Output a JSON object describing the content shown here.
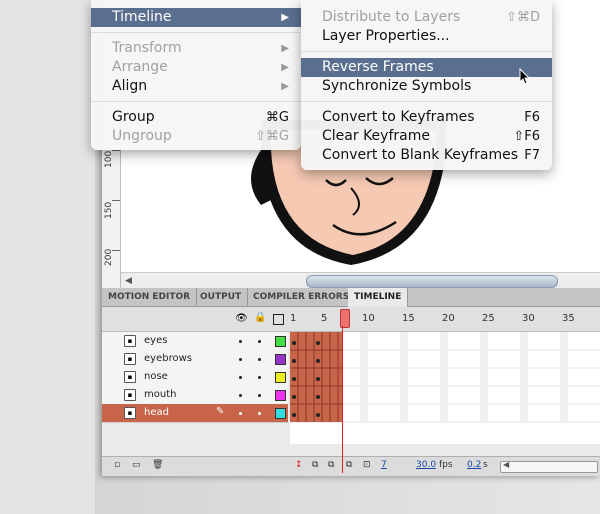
{
  "main_menu": {
    "items": [
      {
        "label": "Timeline",
        "highlighted": true,
        "submenu": true
      },
      {
        "label": "Transform",
        "disabled": true,
        "submenu": true
      },
      {
        "label": "Arrange",
        "disabled": true,
        "submenu": true
      },
      {
        "label": "Align",
        "submenu": true
      },
      {
        "label": "Group",
        "shortcut": "⌘G"
      },
      {
        "label": "Ungroup",
        "shortcut": "⇧⌘G",
        "disabled": true
      }
    ]
  },
  "submenu": {
    "items": [
      {
        "label": "Distribute to Layers",
        "shortcut": "⇧⌘D",
        "disabled": true
      },
      {
        "label": "Layer Properties..."
      },
      {
        "label": "Reverse Frames",
        "highlighted": true
      },
      {
        "label": "Synchronize Symbols"
      },
      {
        "label": "Convert to Keyframes",
        "shortcut": "F6"
      },
      {
        "label": "Clear Keyframe",
        "shortcut": "⇧F6"
      },
      {
        "label": "Convert to Blank Keyframes",
        "shortcut": "F7"
      }
    ]
  },
  "ruler": {
    "ticks": [
      "100",
      "150",
      "200"
    ]
  },
  "panel_tabs": [
    "MOTION EDITOR",
    "OUTPUT",
    "COMPILER ERRORS",
    "TIMELINE"
  ],
  "timeline": {
    "frame_numbers": [
      "1",
      "5",
      "10",
      "15",
      "20",
      "25",
      "30",
      "35"
    ],
    "layers": [
      {
        "name": "eyes",
        "color": "#44dd44"
      },
      {
        "name": "eyebrows",
        "color": "#9933cc"
      },
      {
        "name": "nose",
        "color": "#eeee22"
      },
      {
        "name": "mouth",
        "color": "#ee33ee"
      },
      {
        "name": "head",
        "color": "#33dddd",
        "selected": true
      }
    ],
    "current_frame": "7",
    "fps": "30.0",
    "fps_unit": "fps",
    "time": "0.2",
    "time_unit": "s"
  },
  "colors": {
    "keyframe": "#c8644a",
    "highlight": "#5a6f8f",
    "playhead": "#dd2222"
  }
}
